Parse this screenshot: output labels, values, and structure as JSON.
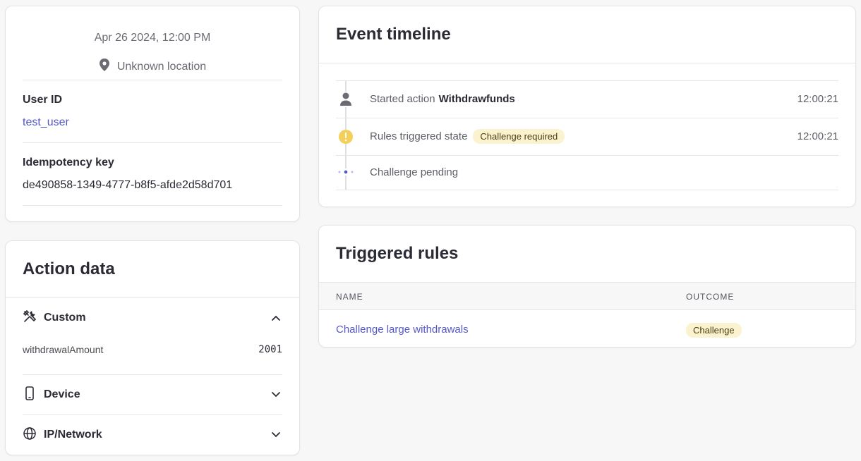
{
  "summary": {
    "datetime": "Apr 26 2024, 12:00 PM",
    "location": "Unknown location",
    "user_id_label": "User ID",
    "user_id_value": "test_user",
    "idempotency_label": "Idempotency key",
    "idempotency_value": "de490858-1349-4777-b8f5-afde2d58d701"
  },
  "action_data": {
    "title": "Action data",
    "sections": [
      {
        "label": "Custom",
        "icon": "tools-icon",
        "expanded": true
      },
      {
        "label": "Device",
        "icon": "phone-icon",
        "expanded": false
      },
      {
        "label": "IP/Network",
        "icon": "globe-icon",
        "expanded": false
      }
    ],
    "custom_fields": [
      {
        "key": "withdrawalAmount",
        "value": "2001"
      }
    ]
  },
  "timeline": {
    "title": "Event timeline",
    "events": [
      {
        "prefix": "Started action",
        "strong": "Withdrawfunds",
        "time": "12:00:21",
        "icon": "user-icon"
      },
      {
        "prefix": "Rules triggered state",
        "badge": "Challenge required",
        "time": "12:00:21",
        "icon": "warning-icon"
      },
      {
        "prefix": "Challenge pending",
        "icon": "pending-dots-icon"
      }
    ]
  },
  "rules": {
    "title": "Triggered rules",
    "columns": [
      "NAME",
      "OUTCOME"
    ],
    "rows": [
      {
        "name": "Challenge large withdrawals",
        "outcome": "Challenge"
      }
    ]
  },
  "colors": {
    "link": "#5558c7",
    "badge_bg": "#fbf2cf",
    "warning": "#f3cf5b",
    "pending": "#4a55c9"
  }
}
